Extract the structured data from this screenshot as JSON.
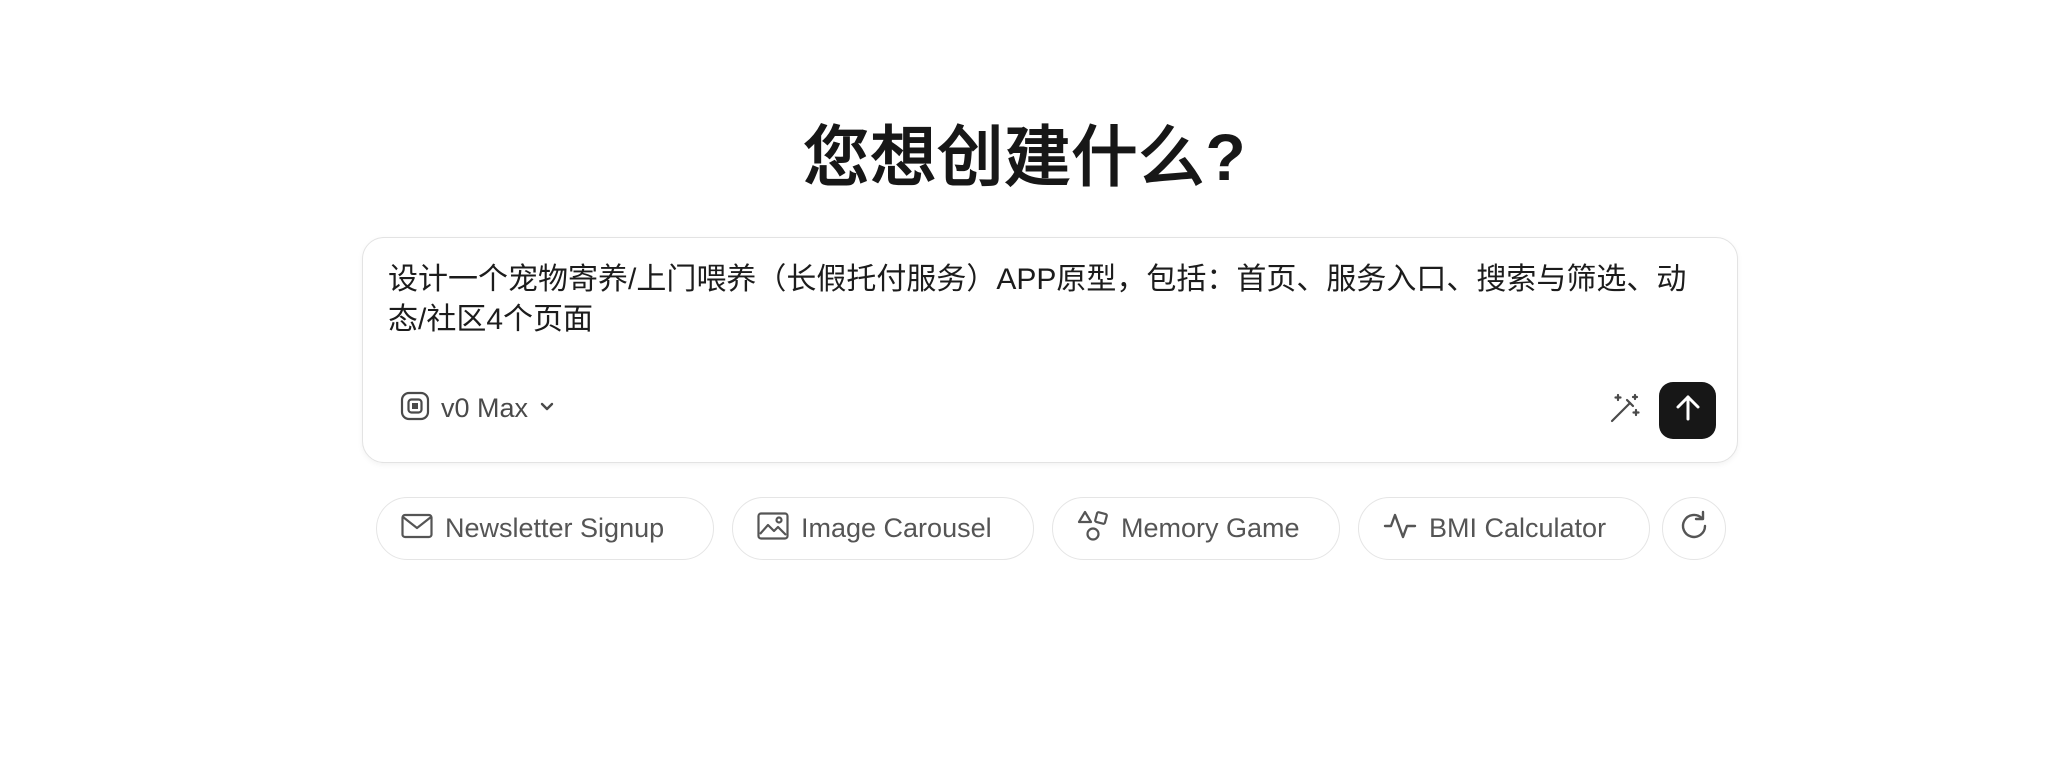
{
  "heading": "您想创建什么?",
  "prompt": {
    "value": "设计一个宠物寄养/上门喂养（长假托付服务）APP原型，包括：首页、服务入口、搜索与筛选、动态/社区4个页面"
  },
  "model": {
    "label": "v0 Max",
    "icon": "model-chip-icon"
  },
  "actions": {
    "enhance_icon": "magic-wand-icon",
    "send_icon": "arrow-up-icon"
  },
  "suggestions": [
    {
      "label": "Newsletter Signup",
      "icon": "mail-icon"
    },
    {
      "label": "Image Carousel",
      "icon": "image-icon"
    },
    {
      "label": "Memory Game",
      "icon": "shapes-icon"
    },
    {
      "label": "BMI Calculator",
      "icon": "activity-icon"
    }
  ],
  "refresh_icon": "refresh-icon",
  "colors": {
    "send_button_bg": "#171717",
    "chip_border": "#e5e5e5",
    "muted_text": "#555555"
  }
}
